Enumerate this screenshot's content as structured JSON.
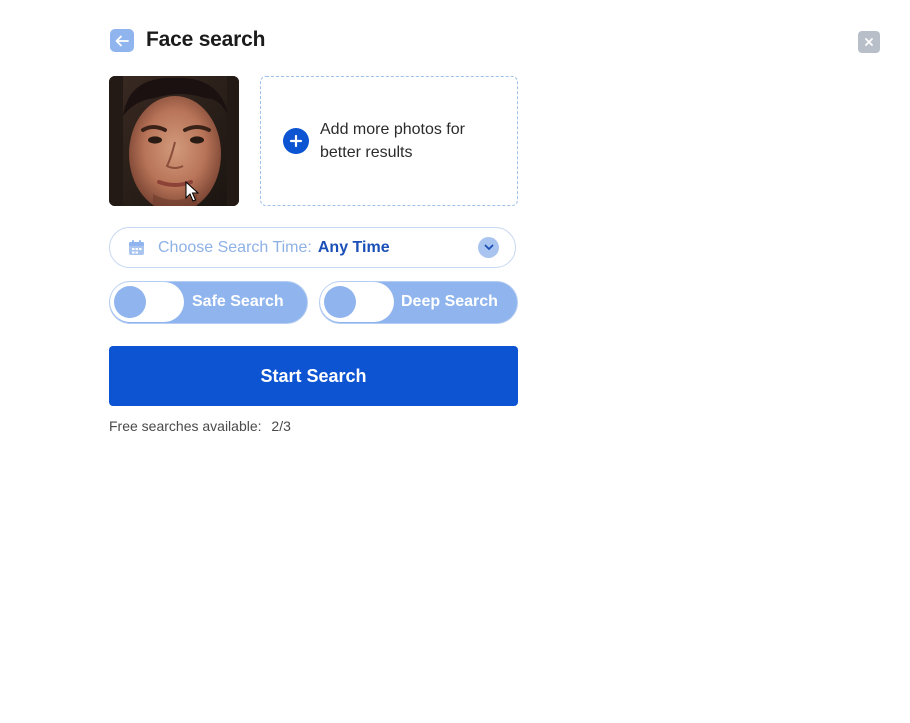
{
  "header": {
    "title": "Face search",
    "back_icon": "arrow-left-icon",
    "close_icon": "close-icon"
  },
  "upload": {
    "add_more_text": "Add more photos for better results",
    "add_icon": "plus-icon"
  },
  "time_filter": {
    "label": "Choose Search Time:",
    "value": "Any Time",
    "icon": "calendar-icon"
  },
  "toggles": {
    "safe_search": {
      "label": "Safe Search",
      "on": false
    },
    "deep_search": {
      "label": "Deep Search",
      "on": false
    }
  },
  "actions": {
    "start_label": "Start Search"
  },
  "footer": {
    "free_label": "Free searches available:",
    "free_count": "2/3"
  },
  "colors": {
    "primary": "#0c54d1",
    "accent_light": "#8fb4ee",
    "border_dashed": "#9fc0ea"
  }
}
